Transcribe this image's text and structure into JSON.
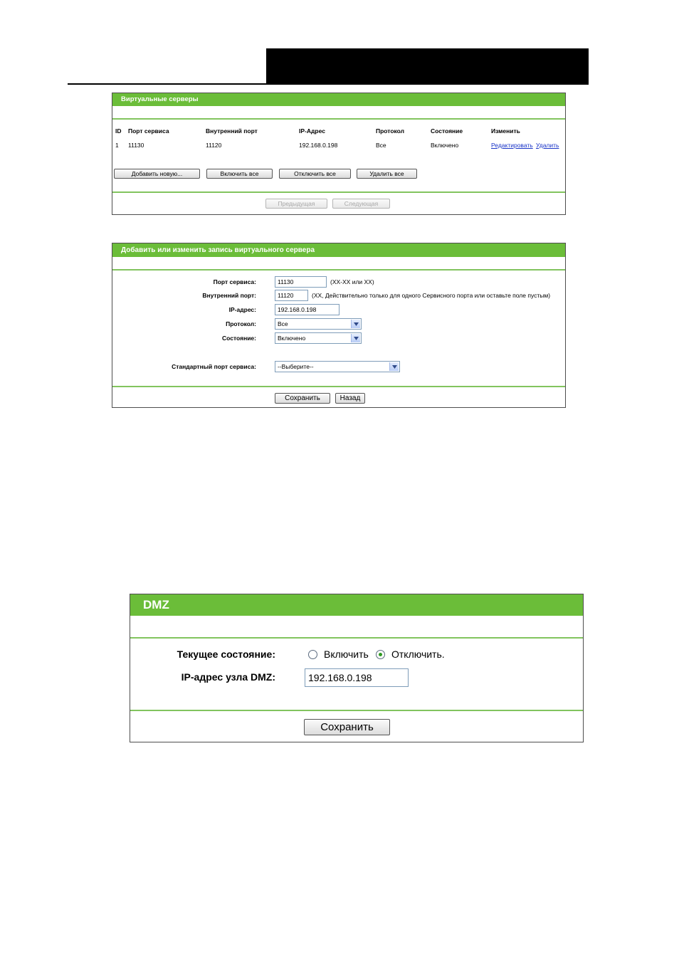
{
  "vs_list": {
    "title": "Виртуальные серверы",
    "columns": [
      "ID",
      "Порт сервиса",
      "Внутренний порт",
      "IP-Адрес",
      "Протокол",
      "Состояние",
      "Изменить"
    ],
    "rows": [
      {
        "id": "1",
        "service_port": "11130",
        "internal_port": "11120",
        "ip": "192.168.0.198",
        "protocol": "Все",
        "status": "Включено",
        "edit": "Редактировать",
        "delete": "Удалить"
      }
    ],
    "buttons": {
      "add_new": "Добавить новую...",
      "enable_all": "Включить все",
      "disable_all": "Отключить все",
      "delete_all": "Удалить все",
      "prev": "Предыдущая",
      "next": "Следующая"
    }
  },
  "vs_form": {
    "title": "Добавить или изменить запись виртуального сервера",
    "labels": {
      "service_port": "Порт сервиса:",
      "internal_port": "Внутренний порт:",
      "ip": "IP-адрес:",
      "protocol": "Протокол:",
      "status": "Состояние:",
      "common_port": "Стандартный порт сервиса:"
    },
    "values": {
      "service_port": "11130",
      "internal_port": "11120",
      "ip": "192.168.0.198",
      "protocol": "Все",
      "status": "Включено",
      "common_port": "--Выберите--"
    },
    "hints": {
      "service_port": "(XX-XX или XX)",
      "internal_port": "(XX, Действительно только для одного Сервисного порта или оставьте поле пустым)"
    },
    "buttons": {
      "save": "Сохранить",
      "back": "Назад"
    }
  },
  "dmz": {
    "title": "DMZ",
    "labels": {
      "status": "Текущее состояние:",
      "host_ip": "IP-адрес узла DMZ:"
    },
    "options": {
      "enable": "Включить",
      "disable": "Отключить."
    },
    "selected": "disable",
    "host_ip": "192.168.0.198",
    "buttons": {
      "save": "Сохранить"
    }
  },
  "colors": {
    "header_green": "#6bbd39",
    "divider_green": "#82c45e",
    "link_blue": "#1a35c8",
    "radio_dot": "#2f9a23"
  }
}
